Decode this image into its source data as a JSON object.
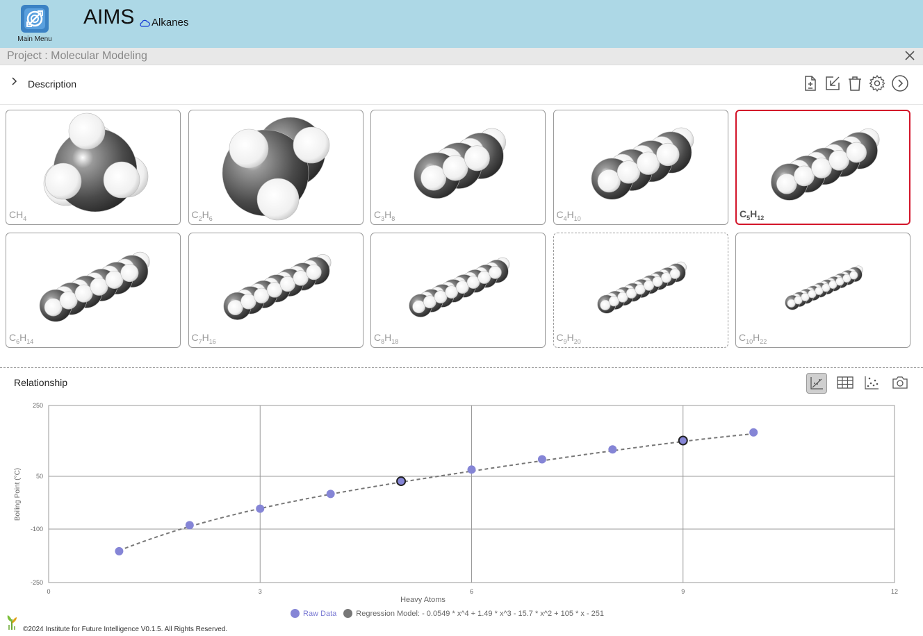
{
  "header": {
    "main_menu_label": "Main Menu",
    "app_title": "AIMS",
    "model_name": "Alkanes"
  },
  "project": {
    "title": "Project : Molecular Modeling"
  },
  "description": {
    "label": "Description"
  },
  "toolbar": {
    "icons": [
      "add-document-icon",
      "import-icon",
      "trash-icon",
      "gear-icon",
      "play-circle-icon"
    ]
  },
  "molecules": [
    {
      "formula_prefix": "C",
      "c": "",
      "h": "4",
      "selected": false,
      "dashed": false
    },
    {
      "formula_prefix": "C",
      "c": "2",
      "h": "6",
      "selected": false,
      "dashed": false
    },
    {
      "formula_prefix": "C",
      "c": "3",
      "h": "8",
      "selected": false,
      "dashed": false
    },
    {
      "formula_prefix": "C",
      "c": "4",
      "h": "10",
      "selected": false,
      "dashed": false
    },
    {
      "formula_prefix": "C",
      "c": "5",
      "h": "12",
      "selected": true,
      "dashed": false
    },
    {
      "formula_prefix": "C",
      "c": "6",
      "h": "14",
      "selected": false,
      "dashed": false
    },
    {
      "formula_prefix": "C",
      "c": "7",
      "h": "16",
      "selected": false,
      "dashed": false
    },
    {
      "formula_prefix": "C",
      "c": "8",
      "h": "18",
      "selected": false,
      "dashed": false
    },
    {
      "formula_prefix": "C",
      "c": "9",
      "h": "20",
      "selected": false,
      "dashed": true
    },
    {
      "formula_prefix": "C",
      "c": "10",
      "h": "22",
      "selected": false,
      "dashed": false
    }
  ],
  "relationship": {
    "label": "Relationship",
    "icons": [
      "regression-icon",
      "table-icon",
      "scatter-icon",
      "camera-icon"
    ]
  },
  "chart_data": {
    "type": "scatter",
    "xlabel": "Heavy Atoms",
    "ylabel": "Boiling Point (°C)",
    "xlim": [
      0,
      12
    ],
    "ylim": [
      -250,
      250
    ],
    "xticks": [
      0,
      3,
      6,
      9,
      12
    ],
    "yticks": [
      -250,
      -100,
      50,
      250
    ],
    "grid": true,
    "series": [
      {
        "name": "Raw Data",
        "color": "#8585d6",
        "x": [
          1,
          2,
          3,
          4,
          5,
          6,
          7,
          8,
          9,
          10
        ],
        "y": [
          -162,
          -89,
          -42,
          0,
          36,
          69,
          98,
          126,
          151,
          174
        ]
      }
    ],
    "highlighted_points": [
      5,
      9
    ],
    "regression": {
      "name": "Regression Model: - 0.0549 * x^4 + 1.49 * x^3 - 15.7 * x^2 + 105 * x - 251",
      "color": "#777777",
      "coefficients": [
        -0.0549,
        1.49,
        -15.7,
        105,
        -251
      ],
      "x_range": [
        1,
        10
      ]
    },
    "legend_position": "bottom"
  },
  "footer": {
    "text": "©2024 Institute for Future Intelligence V0.1.5. All Rights Reserved."
  }
}
